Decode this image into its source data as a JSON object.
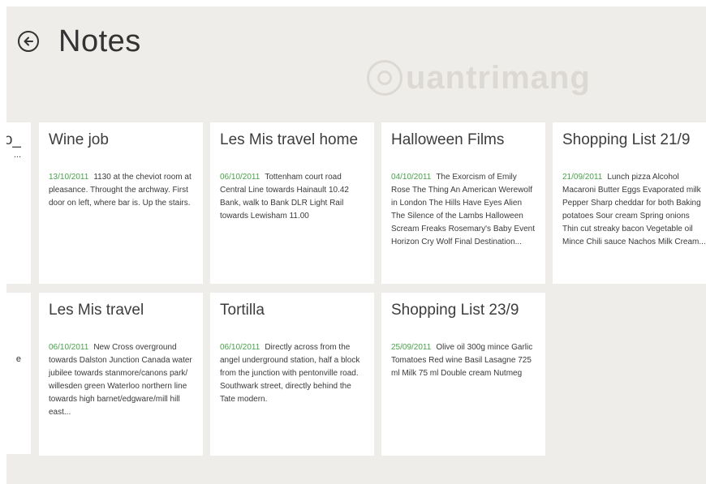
{
  "header": {
    "title": "Notes",
    "watermark": "uantrimang"
  },
  "partial_cards": [
    {
      "title": "o_",
      "line": "..."
    },
    {
      "title": "",
      "line": "e"
    }
  ],
  "notes": [
    {
      "title": "Wine job",
      "date": "13/10/2011",
      "body": "1130 at the cheviot room at pleasance. Throught the archway. First door on left, where bar is. Up the stairs."
    },
    {
      "title": "Les Mis travel home",
      "date": "06/10/2011",
      "body": "Tottenham court road Central Line towards Hainault 10.42 Bank, walk to Bank DLR Light Rail towards Lewisham 11.00"
    },
    {
      "title": "Halloween Films",
      "date": "04/10/2011",
      "body": "The Exorcism of Emily Rose The Thing An American Werewolf in London The Hills Have Eyes Alien The Silence of the Lambs Halloween Scream Freaks Rosemary's Baby Event Horizon Cry Wolf Final Destination..."
    },
    {
      "title": "Shopping List 21/9",
      "date": "21/09/2011",
      "body": "Lunch pizza Alcohol Macaroni Butter Eggs Evaporated milk Pepper Sharp cheddar for both Baking potatoes Sour cream Spring onions Thin cut streaky bacon Vegetable oil Mince Chili sauce Nachos Milk Cream..."
    },
    {
      "title": "Les Mis travel",
      "date": "06/10/2011",
      "body": "New Cross overground towards Dalston Junction Canada water jubilee towards stanmore/canons park/ willesden green Waterloo northern line towards high barnet/edgware/mill hill east..."
    },
    {
      "title": "Tortilla",
      "date": "06/10/2011",
      "body": "Directly across from the angel underground station, half a block from the junction with pentonville road. Southwark street, directly behind the Tate modern."
    },
    {
      "title": "Shopping List 23/9",
      "date": "25/09/2011",
      "body": "Olive oil 300g mince Garlic Tomatoes Red wine Basil Lasagne 725 ml Milk 75 ml Double cream Nutmeg"
    }
  ]
}
